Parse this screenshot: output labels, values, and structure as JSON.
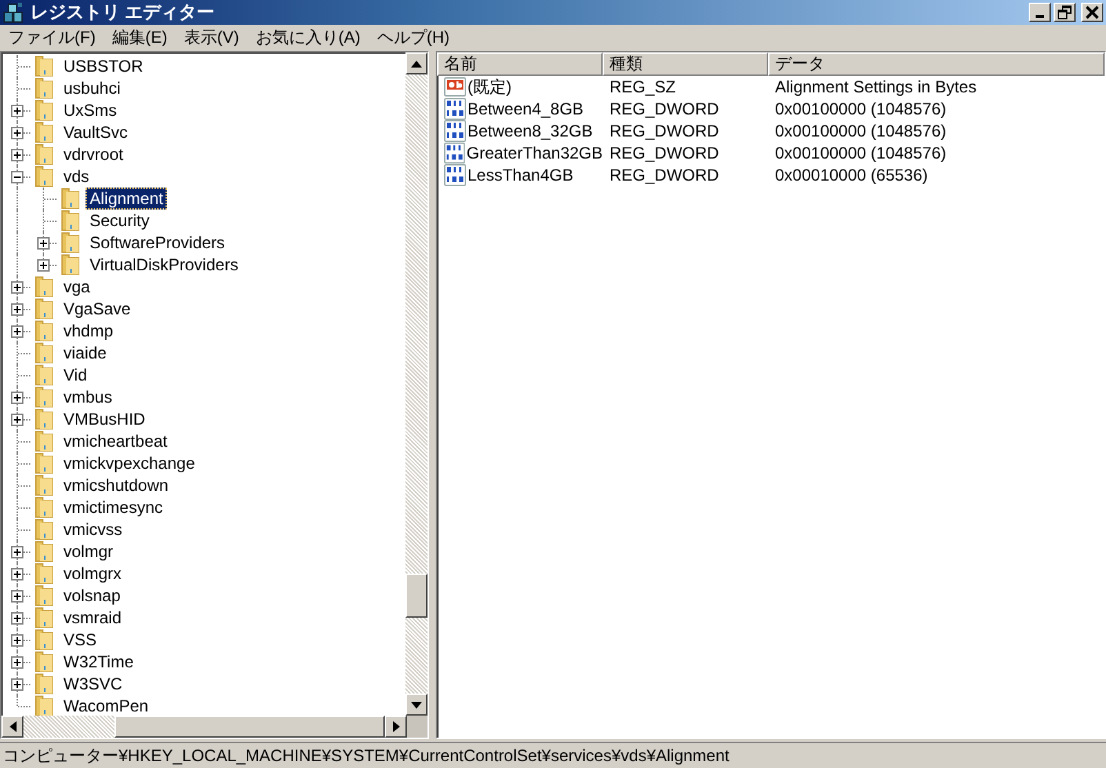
{
  "window": {
    "title": "レジストリ エディター"
  },
  "menu": [
    "ファイル(F)",
    "編集(E)",
    "表示(V)",
    "お気に入り(A)",
    "ヘルプ(H)"
  ],
  "tree": [
    {
      "label": "USBSTOR",
      "selected": false
    },
    {
      "label": "usbuhci",
      "selected": false
    },
    {
      "label": "UxSms",
      "selected": false,
      "expanded": false
    },
    {
      "label": "VaultSvc",
      "selected": false,
      "expanded": false
    },
    {
      "label": "vdrvroot",
      "selected": false,
      "expanded": false
    },
    {
      "label": "vds",
      "selected": false,
      "expanded": true,
      "children": [
        {
          "label": "Alignment",
          "selected": true
        },
        {
          "label": "Security",
          "selected": false
        },
        {
          "label": "SoftwareProviders",
          "selected": false,
          "expanded": false
        },
        {
          "label": "VirtualDiskProviders",
          "selected": false,
          "expanded": false
        }
      ]
    },
    {
      "label": "vga",
      "selected": false,
      "expanded": false
    },
    {
      "label": "VgaSave",
      "selected": false,
      "expanded": false
    },
    {
      "label": "vhdmp",
      "selected": false,
      "expanded": false
    },
    {
      "label": "viaide",
      "selected": false
    },
    {
      "label": "Vid",
      "selected": false
    },
    {
      "label": "vmbus",
      "selected": false,
      "expanded": false
    },
    {
      "label": "VMBusHID",
      "selected": false,
      "expanded": false
    },
    {
      "label": "vmicheartbeat",
      "selected": false
    },
    {
      "label": "vmickvpexchange",
      "selected": false
    },
    {
      "label": "vmicshutdown",
      "selected": false
    },
    {
      "label": "vmictimesync",
      "selected": false
    },
    {
      "label": "vmicvss",
      "selected": false
    },
    {
      "label": "volmgr",
      "selected": false,
      "expanded": false
    },
    {
      "label": "volmgrx",
      "selected": false,
      "expanded": false
    },
    {
      "label": "volsnap",
      "selected": false,
      "expanded": false
    },
    {
      "label": "vsmraid",
      "selected": false,
      "expanded": false
    },
    {
      "label": "VSS",
      "selected": false,
      "expanded": false
    },
    {
      "label": "W32Time",
      "selected": false,
      "expanded": false
    },
    {
      "label": "W3SVC",
      "selected": false,
      "expanded": false
    },
    {
      "label": "WacomPen",
      "selected": false
    }
  ],
  "values": {
    "columns": [
      "名前",
      "種類",
      "データ"
    ],
    "rows": [
      {
        "kind": "string",
        "name": "(既定)",
        "type": "REG_SZ",
        "data": "Alignment Settings in Bytes"
      },
      {
        "kind": "binary",
        "name": "Between4_8GB",
        "type": "REG_DWORD",
        "data": "0x00100000 (1048576)"
      },
      {
        "kind": "binary",
        "name": "Between8_32GB",
        "type": "REG_DWORD",
        "data": "0x00100000 (1048576)"
      },
      {
        "kind": "binary",
        "name": "GreaterThan32GB",
        "type": "REG_DWORD",
        "data": "0x00100000 (1048576)"
      },
      {
        "kind": "binary",
        "name": "LessThan4GB",
        "type": "REG_DWORD",
        "data": "0x00010000 (65536)"
      }
    ]
  },
  "status_bar": "コンピューター¥HKEY_LOCAL_MACHINE¥SYSTEM¥CurrentControlSet¥services¥vds¥Alignment"
}
